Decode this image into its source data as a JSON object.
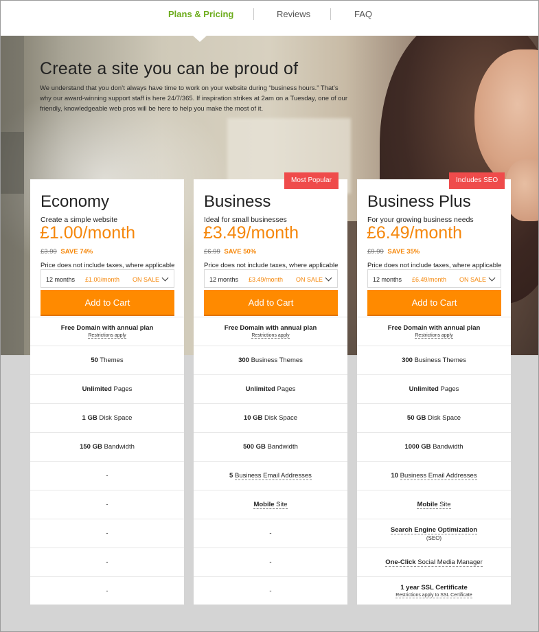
{
  "nav": {
    "tabs": [
      {
        "label": "Plans & Pricing",
        "active": true
      },
      {
        "label": "Reviews",
        "active": false
      },
      {
        "label": "FAQ",
        "active": false
      }
    ]
  },
  "hero": {
    "title": "Create a site you can be proud of",
    "intro": "We understand that you don’t always have time to work on your website during “business hours.” That’s why our award-winning support staff is here 24/7/365. If inspiration strikes at 2am on a Tuesday, one of our friendly, knowledgeable web pros will be here to help you make the most of it."
  },
  "colors": {
    "accent_green": "#6bab1a",
    "price_orange": "#f5870b",
    "cart_orange": "#ff8a00",
    "badge_red": "#ef4b4b"
  },
  "plans": [
    {
      "name": "Economy",
      "tagline": "Create a simple website",
      "price": "£1.00/month",
      "old_price": "£3.99",
      "save": "SAVE 74%",
      "tax_note": "Price does not include taxes, where applicable",
      "term": "12 months",
      "term_price": "£1.00/month",
      "sale_label": "ON SALE",
      "cart_label": "Add to Cart",
      "f1_bold": "Free Domain with annual plan",
      "f1_sub": "Restrictions apply",
      "f2_bold": "50",
      "f2_text": "Themes",
      "f3_bold": "Unlimited",
      "f3_text": "Pages",
      "f4_bold": "1 GB",
      "f4_text": "Disk Space",
      "f5_bold": "150 GB",
      "f5_text": "Bandwidth",
      "f6": "-",
      "f7": "-",
      "f8": "-",
      "f9": "-",
      "f10": "-"
    },
    {
      "name": "Business",
      "badge": "Most Popular",
      "tagline": "Ideal for small businesses",
      "price": "£3.49/month",
      "old_price": "£6.99",
      "save": "SAVE 50%",
      "tax_note": "Price does not include taxes, where applicable",
      "term": "12 months",
      "term_price": "£3.49/month",
      "sale_label": "ON SALE",
      "cart_label": "Add to Cart",
      "f1_bold": "Free Domain with annual plan",
      "f1_sub": "Restrictions apply",
      "f2_bold": "300",
      "f2_text": "Business Themes",
      "f3_bold": "Unlimited",
      "f3_text": "Pages",
      "f4_bold": "10 GB",
      "f4_text": "Disk Space",
      "f5_bold": "500 GB",
      "f5_text": "Bandwidth",
      "f6_bold": "5",
      "f6_text": "Business Email Addresses",
      "f7_bold": "Mobile",
      "f7_text": "Site",
      "f8": "-",
      "f9": "-",
      "f10": "-"
    },
    {
      "name": "Business Plus",
      "badge": "Includes SEO",
      "tagline": "For your growing business needs",
      "price": "£6.49/month",
      "old_price": "£9.99",
      "save": "SAVE 35%",
      "tax_note": "Price does not include taxes, where applicable",
      "term": "12 months",
      "term_price": "£6.49/month",
      "sale_label": "ON SALE",
      "cart_label": "Add to Cart",
      "f1_bold": "Free Domain with annual plan",
      "f1_sub": "Restrictions apply",
      "f2_bold": "300",
      "f2_text": "Business Themes",
      "f3_bold": "Unlimited",
      "f3_text": "Pages",
      "f4_bold": "50 GB",
      "f4_text": "Disk Space",
      "f5_bold": "1000 GB",
      "f5_text": "Bandwidth",
      "f6_bold": "10",
      "f6_text": "Business Email Addresses",
      "f7_bold": "Mobile",
      "f7_text": "Site",
      "f8_bold": "Search Engine Optimization",
      "f8_sub": "(SEO)",
      "f9_bold": "One-Click",
      "f9_text": "Social Media Manager",
      "f10_bold": "1 year SSL Certificate",
      "f10_sub": "Restrictions apply to SSL Certificate"
    }
  ]
}
